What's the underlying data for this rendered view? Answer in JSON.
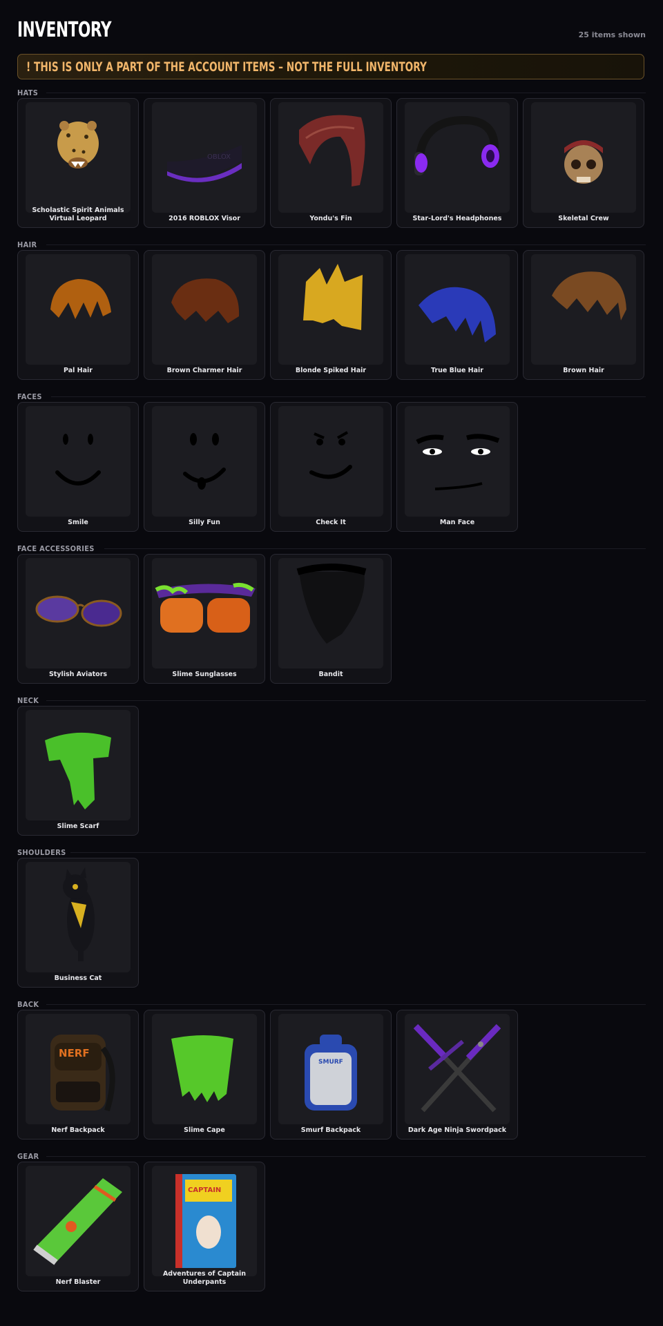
{
  "header": {
    "title": "INVENTORY",
    "count": "25 items shown"
  },
  "notice": {
    "text": "! THIS IS ONLY A PART OF THE ACCOUNT ITEMS – NOT THE FULL INVENTORY"
  },
  "sections": [
    {
      "title": "HATS",
      "items": [
        {
          "name": "Scholastic Spirit Animals Virtual Leopard",
          "icon": "leopard-head"
        },
        {
          "name": "2016 ROBLOX Visor",
          "icon": "visor"
        },
        {
          "name": "Yondu's Fin",
          "icon": "fin"
        },
        {
          "name": "Star-Lord's Headphones",
          "icon": "headphones"
        },
        {
          "name": "Skeletal Crew",
          "icon": "skull"
        }
      ]
    },
    {
      "title": "HAIR",
      "items": [
        {
          "name": "Pal Hair",
          "icon": "hair-orange"
        },
        {
          "name": "Brown Charmer Hair",
          "icon": "hair-brown"
        },
        {
          "name": "Blonde Spiked Hair",
          "icon": "hair-blonde"
        },
        {
          "name": "True Blue Hair",
          "icon": "hair-blue"
        },
        {
          "name": "Brown Hair",
          "icon": "hair-brown-swept"
        }
      ]
    },
    {
      "title": "FACES",
      "items": [
        {
          "name": "Smile",
          "icon": "face-smile"
        },
        {
          "name": "Silly Fun",
          "icon": "face-silly"
        },
        {
          "name": "Check It",
          "icon": "face-check"
        },
        {
          "name": "Man Face",
          "icon": "face-man"
        }
      ]
    },
    {
      "title": "FACE ACCESSORIES",
      "items": [
        {
          "name": "Stylish Aviators",
          "icon": "aviators"
        },
        {
          "name": "Slime Sunglasses",
          "icon": "slime-sunglasses"
        },
        {
          "name": "Bandit",
          "icon": "bandit"
        }
      ]
    },
    {
      "title": "NECK",
      "items": [
        {
          "name": "Slime Scarf",
          "icon": "slime-scarf"
        }
      ]
    },
    {
      "title": "SHOULDERS",
      "items": [
        {
          "name": "Business Cat",
          "icon": "cat"
        }
      ]
    },
    {
      "title": "BACK",
      "items": [
        {
          "name": "Nerf Backpack",
          "icon": "nerf-backpack"
        },
        {
          "name": "Slime Cape",
          "icon": "slime-cape"
        },
        {
          "name": "Smurf Backpack",
          "icon": "smurf-backpack"
        },
        {
          "name": "Dark Age Ninja Swordpack",
          "icon": "swords"
        }
      ]
    },
    {
      "title": "GEAR",
      "items": [
        {
          "name": "Nerf Blaster",
          "icon": "blaster"
        },
        {
          "name": "Adventures of Captain Underpants",
          "icon": "book"
        }
      ]
    }
  ]
}
